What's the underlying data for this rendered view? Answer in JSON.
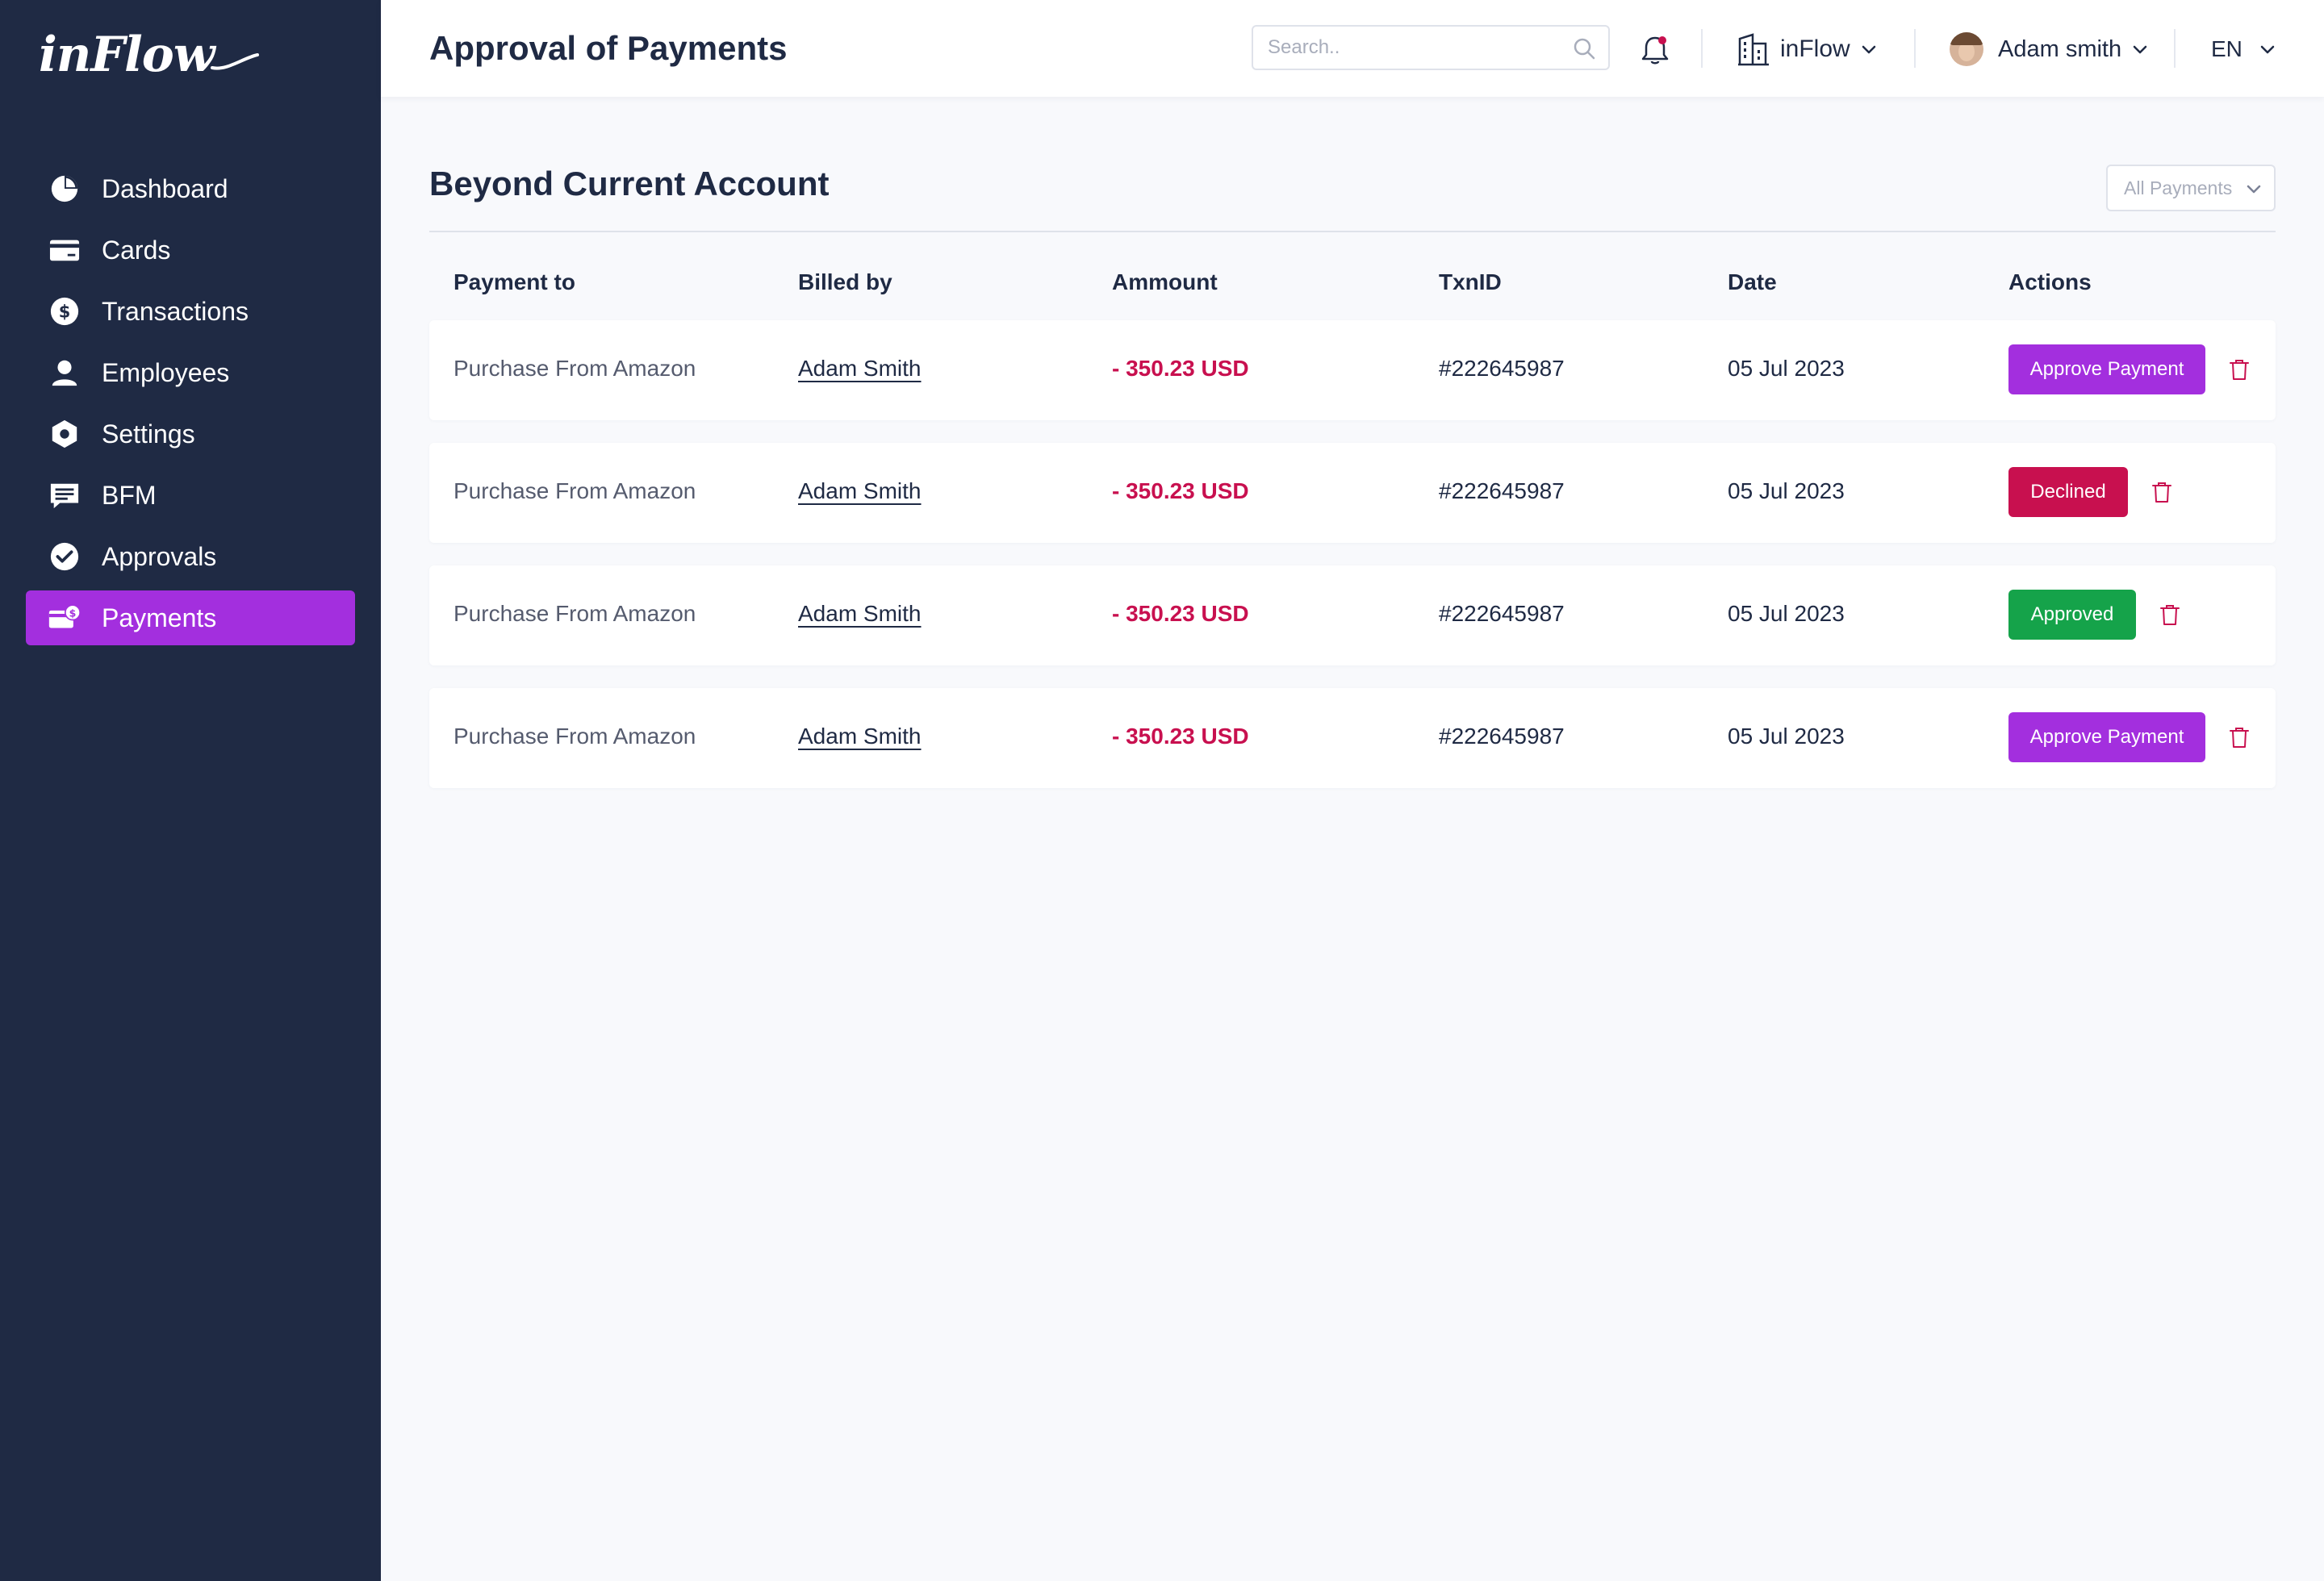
{
  "app": {
    "logo_text": "inFlow"
  },
  "sidebar": {
    "items": [
      {
        "label": "Dashboard",
        "icon": "pie-chart-icon"
      },
      {
        "label": "Cards",
        "icon": "card-icon"
      },
      {
        "label": "Transactions",
        "icon": "dollar-circle-icon"
      },
      {
        "label": "Employees",
        "icon": "user-icon"
      },
      {
        "label": "Settings",
        "icon": "hexagon-gear-icon"
      },
      {
        "label": "BFM",
        "icon": "message-icon"
      },
      {
        "label": "Approvals",
        "icon": "check-circle-icon"
      },
      {
        "label": "Payments",
        "icon": "payments-icon",
        "active": true
      }
    ]
  },
  "header": {
    "title": "Approval of Payments",
    "search_placeholder": "Search..",
    "company": "inFlow",
    "user_name": "Adam smith",
    "language": "EN"
  },
  "section": {
    "title": "Beyond Current Account",
    "filter": "All Payments"
  },
  "table": {
    "columns": [
      "Payment to",
      "Billed by",
      "Ammount",
      "TxnID",
      "Date",
      "Actions"
    ],
    "rows": [
      {
        "payment_to": "Purchase From Amazon",
        "billed_by": "Adam Smith",
        "amount": "- 350.23 USD",
        "txn_id": "#222645987",
        "date": "05 Jul 2023",
        "action": "Approve Payment",
        "status": "approve"
      },
      {
        "payment_to": "Purchase From Amazon",
        "billed_by": "Adam Smith",
        "amount": "- 350.23 USD",
        "txn_id": "#222645987",
        "date": "05 Jul 2023",
        "action": "Declined",
        "status": "declined"
      },
      {
        "payment_to": "Purchase From Amazon",
        "billed_by": "Adam Smith",
        "amount": "- 350.23 USD",
        "txn_id": "#222645987",
        "date": "05 Jul 2023",
        "action": "Approved",
        "status": "approved"
      },
      {
        "payment_to": "Purchase From Amazon",
        "billed_by": "Adam Smith",
        "amount": "- 350.23 USD",
        "txn_id": "#222645987",
        "date": "05 Jul 2023",
        "action": "Approve Payment",
        "status": "approve"
      }
    ]
  },
  "colors": {
    "sidebar_bg": "#1f2a44",
    "accent": "#a32fde",
    "negative": "#c8104f",
    "success": "#15a34a"
  }
}
